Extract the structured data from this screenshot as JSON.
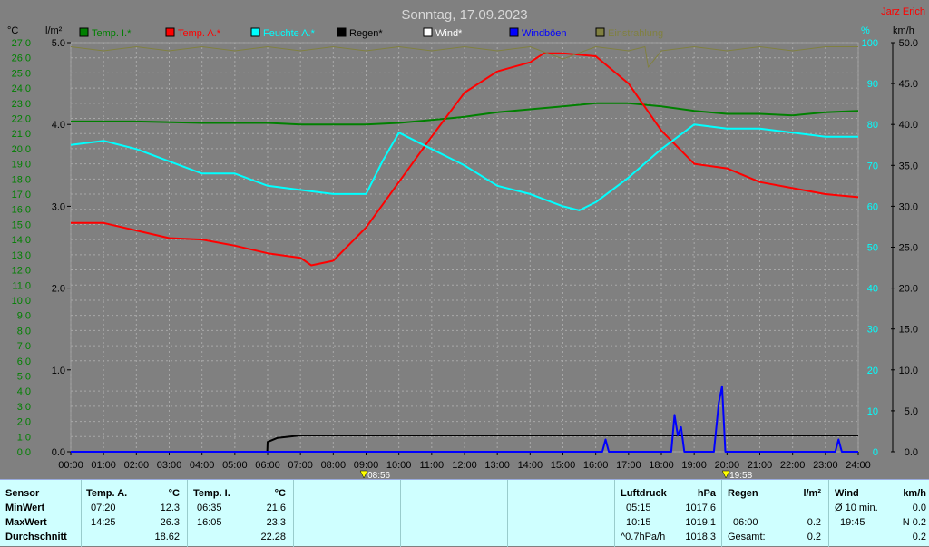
{
  "title": "Sonntag, 17.09.2023",
  "author": "Jarz Erich",
  "legend": [
    {
      "label": "Temp. I.*",
      "color": "#008000"
    },
    {
      "label": "Temp. A.*",
      "color": "#ff0000"
    },
    {
      "label": "Feuchte A.*",
      "color": "#00ffff"
    },
    {
      "label": "Regen*",
      "color": "#000000"
    },
    {
      "label": "Wind*",
      "color": "#ffffff"
    },
    {
      "label": "Windböen",
      "color": "#0000ff"
    },
    {
      "label": "Einstrahlung",
      "color": "#808040"
    }
  ],
  "axes": {
    "left_temp_unit": "°C",
    "left_rain_unit": "l/m²",
    "right_percent_unit": "%",
    "right_wind_unit": "km/h",
    "temp_ticks": [
      "27.0",
      "26.0",
      "25.0",
      "24.0",
      "23.0",
      "22.0",
      "21.0",
      "20.0",
      "19.0",
      "18.0",
      "17.0",
      "16.0",
      "15.0",
      "14.0",
      "13.0",
      "12.0",
      "11.0",
      "10.0",
      "9.0",
      "8.0",
      "7.0",
      "6.0",
      "5.0",
      "4.0",
      "3.0",
      "2.0",
      "1.0",
      "0.0"
    ],
    "rain_ticks": [
      "5.0",
      "4.0",
      "3.0",
      "2.0",
      "1.0",
      "0.0"
    ],
    "percent_ticks": [
      "100",
      "90",
      "80",
      "70",
      "60",
      "50",
      "40",
      "30",
      "20",
      "10",
      "0"
    ],
    "wind_ticks": [
      "50.0",
      "45.0",
      "40.0",
      "35.0",
      "30.0",
      "25.0",
      "20.0",
      "15.0",
      "10.0",
      "5.0",
      "0.0"
    ],
    "time_ticks": [
      "00:00",
      "01:00",
      "02:00",
      "03:00",
      "04:00",
      "05:00",
      "06:00",
      "07:00",
      "08:00",
      "09:00",
      "10:00",
      "11:00",
      "12:00",
      "13:00",
      "14:00",
      "15:00",
      "16:00",
      "17:00",
      "18:00",
      "19:00",
      "20:00",
      "21:00",
      "22:00",
      "23:00",
      "24:00"
    ],
    "sunrise": "08:56",
    "sunset": "19:58"
  },
  "chart_data": {
    "type": "line",
    "title": "Sonntag, 17.09.2023",
    "x_unit": "hour",
    "xlim": [
      0,
      24
    ],
    "temp_ylim": [
      0,
      27
    ],
    "rain_ylim": [
      0,
      5
    ],
    "percent_ylim": [
      0,
      100
    ],
    "wind_ylim": [
      0,
      50
    ],
    "series": [
      {
        "name": "Temp. I.*",
        "axis": "temp",
        "color": "#008000",
        "x": [
          0,
          2,
          4,
          6,
          7,
          8,
          9,
          10,
          11,
          12,
          13,
          14,
          15,
          16,
          17,
          18,
          19,
          20,
          21,
          22,
          23,
          24
        ],
        "y": [
          21.8,
          21.8,
          21.7,
          21.7,
          21.6,
          21.6,
          21.6,
          21.7,
          21.9,
          22.1,
          22.4,
          22.6,
          22.8,
          23.0,
          23.0,
          22.8,
          22.5,
          22.3,
          22.3,
          22.2,
          22.4,
          22.5
        ]
      },
      {
        "name": "Temp. A.*",
        "axis": "temp",
        "color": "#ff0000",
        "x": [
          0,
          1,
          2,
          3,
          4,
          5,
          6,
          7,
          7.33,
          8,
          9,
          10,
          11,
          12,
          13,
          14,
          14.42,
          15,
          16,
          17,
          18,
          19,
          20,
          21,
          22,
          23,
          24
        ],
        "y": [
          15.1,
          15.1,
          14.6,
          14.1,
          14.0,
          13.6,
          13.1,
          12.8,
          12.3,
          12.6,
          14.8,
          17.8,
          20.8,
          23.7,
          25.1,
          25.7,
          26.3,
          26.3,
          26.1,
          24.3,
          21.2,
          19.0,
          18.7,
          17.8,
          17.4,
          17.0,
          16.8
        ]
      },
      {
        "name": "Feuchte A.*",
        "axis": "percent",
        "color": "#00ffff",
        "x": [
          0,
          1,
          2,
          3,
          4,
          5,
          6,
          7,
          8,
          9,
          9.5,
          10,
          11,
          12,
          13,
          14,
          15,
          15.5,
          16,
          17,
          18,
          19,
          20,
          21,
          22,
          23,
          24
        ],
        "y": [
          75,
          76,
          74,
          71,
          68,
          68,
          65,
          64,
          63,
          63,
          71,
          78,
          74,
          70,
          65,
          63,
          60,
          59,
          61,
          67,
          74,
          80,
          79,
          79,
          78,
          77,
          77
        ]
      },
      {
        "name": "Regen*",
        "axis": "rain",
        "color": "#000000",
        "x": [
          0,
          5.99,
          6.0,
          6.3,
          7,
          8,
          9,
          10,
          12,
          14,
          16,
          18,
          20,
          22,
          24
        ],
        "y": [
          0,
          0,
          0.12,
          0.17,
          0.2,
          0.2,
          0.2,
          0.2,
          0.2,
          0.2,
          0.2,
          0.2,
          0.2,
          0.2,
          0.2
        ]
      },
      {
        "name": "Windböen",
        "axis": "wind",
        "color": "#0000ff",
        "x": [
          0,
          16.2,
          16.3,
          16.4,
          18.3,
          18.4,
          18.5,
          18.6,
          18.7,
          19.6,
          19.75,
          19.85,
          19.95,
          20.05,
          23.3,
          23.4,
          23.5,
          24
        ],
        "y": [
          0,
          0,
          1.5,
          0,
          0,
          4.5,
          2,
          3,
          0,
          0,
          6,
          8,
          0,
          0,
          0,
          1.5,
          0,
          0
        ]
      },
      {
        "name": "Einstrahlung",
        "axis": "percent",
        "color": "#808040",
        "x": [
          0,
          1,
          2,
          3,
          4,
          5,
          6,
          7,
          8,
          9,
          10,
          11,
          12,
          13,
          14,
          15,
          16,
          17,
          17.5,
          17.6,
          18,
          19,
          20,
          21,
          22,
          23,
          24
        ],
        "y": [
          99,
          98,
          99,
          98,
          99,
          98,
          99,
          98,
          99,
          98,
          99,
          98,
          99,
          98,
          99,
          96,
          99,
          98,
          99,
          94,
          98,
          99,
          98,
          99,
          98,
          99,
          99
        ]
      }
    ]
  },
  "stats": {
    "sensor": {
      "header": "Sensor",
      "rows": [
        "MinWert",
        "MaxWert",
        "Durchschnitt"
      ]
    },
    "temp_a": {
      "header": "Temp. A.",
      "unit": "°C",
      "min_time": "07:20",
      "min_val": "12.3",
      "max_time": "14:25",
      "max_val": "26.3",
      "avg_val": "18.62"
    },
    "temp_i": {
      "header": "Temp. I.",
      "unit": "°C",
      "min_time": "06:35",
      "min_val": "21.6",
      "max_time": "16:05",
      "max_val": "23.3",
      "avg_val": "22.28"
    },
    "luftdruck": {
      "header": "Luftdruck",
      "unit": "hPa",
      "r1_time": "05:15",
      "r1_val": "1017.6",
      "r2_time": "10:15",
      "r2_val": "1019.1",
      "r3_label": "^0.7hPa/h",
      "r3_val": "1018.3"
    },
    "regen": {
      "header": "Regen",
      "unit": "l/m²",
      "r2_time": "06:00",
      "r2_val": "0.2",
      "r3_label": "Gesamt:",
      "r3_val": "0.2"
    },
    "wind": {
      "header": "Wind",
      "unit": "km/h",
      "r1_label": "Ø 10 min.",
      "r1_val": "0.0",
      "r2_time": "19:45",
      "r2_val": "N 0.2",
      "r3_val": "0.2"
    }
  }
}
